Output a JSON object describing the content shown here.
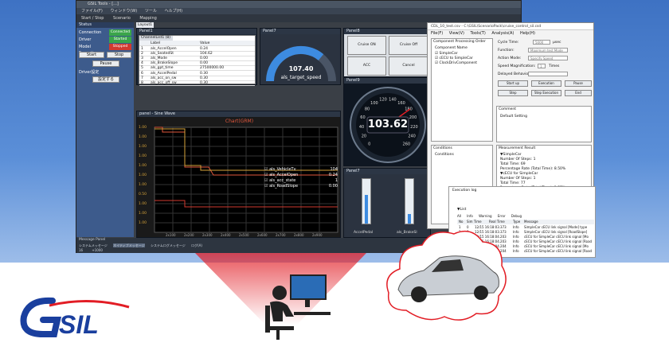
{
  "main_window": {
    "title": "GSIL Tools - [...]",
    "menu": [
      "ファイル(F)",
      "ウィンドウ(W)",
      "ツール",
      "ヘルプ(H)"
    ],
    "toolbar": [
      "Start / Stop",
      "Scenario",
      "Mapping"
    ]
  },
  "status": {
    "title": "Status",
    "rows": [
      {
        "label": "Connection",
        "value": "Connected",
        "color": "#3aa54a"
      },
      {
        "label": "Driver",
        "value": "Started",
        "color": "#3aa54a"
      },
      {
        "label": "Model Execution",
        "value": "Stopped",
        "color": "#d23a2f"
      }
    ],
    "start": "Start",
    "stop": "Stop",
    "pause": "Pause",
    "driver_label": "Driver設定",
    "settings": "設定する"
  },
  "layout_tab": "Layout1",
  "channel_list": {
    "panel": "Panel1",
    "tab": "ChannelList1 (8)",
    "cols": [
      "Label",
      "Value"
    ],
    "rows": [
      {
        "n": "1",
        "label": "als_AccelOpen",
        "value": "0.24"
      },
      {
        "n": "2",
        "label": "als_SeatedSt",
        "value": "104.62"
      },
      {
        "n": "3",
        "label": "als_Mode",
        "value": "0.00"
      },
      {
        "n": "4",
        "label": "als_BrakeSlope",
        "value": "0.00"
      },
      {
        "n": "5",
        "label": "als_gpt_time",
        "value": "27500000.00"
      },
      {
        "n": "6",
        "label": "als_AccelPedal",
        "value": "0.30"
      },
      {
        "n": "7",
        "label": "als_acc_on_sw",
        "value": "0.30"
      },
      {
        "n": "8",
        "label": "als_acc_off_sw",
        "value": "0.30"
      }
    ]
  },
  "gauge": {
    "panel": "Panel7",
    "value": "107.40",
    "label": "als_target_speed"
  },
  "cruise": {
    "panel": "Panel8",
    "buttons": [
      "Cruise ON",
      "Cruise Off",
      "ACC",
      "Cancel"
    ]
  },
  "speedometer": {
    "panel": "Panel9",
    "value": "103.62",
    "ticks": [
      "0",
      "20",
      "40",
      "60",
      "80",
      "100",
      "120",
      "140",
      "160",
      "180",
      "200",
      "220",
      "240",
      "260"
    ]
  },
  "chart": {
    "panel": "panel - Sine Wave",
    "title": "Chart(GRM)",
    "legend": [
      {
        "name": "als_VehicleTv",
        "value": "104"
      },
      {
        "name": "als_AccelOpen",
        "value": "0.24"
      },
      {
        "name": "als_acc_state",
        "value": "1"
      },
      {
        "name": "als_RoadSlope",
        "value": "0.00"
      }
    ],
    "y_ticks": [
      "1.00",
      "1.00",
      "1.00",
      "1.00",
      "1.00",
      "1.00",
      "1.00",
      "0.50",
      "1.00",
      "1.00",
      "1.00"
    ],
    "x_ticks": [
      "2x100",
      "2x200",
      "2x300",
      "2x400",
      "2x500",
      "2x600",
      "2x700",
      "2x800",
      "2x900"
    ]
  },
  "sliders": {
    "panel": "Panel7",
    "labels": [
      "AccelPedal",
      "als_BrakeSl"
    ]
  },
  "message_panel": {
    "title": "Message Panel",
    "tabs": [
      "システムメッセージ",
      "ネイティブメッセージ",
      "システムログメッセージ",
      "ログ(A)"
    ],
    "col1": "ID",
    "col2": "メッセージ",
    "row_id": "16",
    "row_val": "+1000"
  },
  "scenario": {
    "title": "CDL_10_test.csv - C:\\GSIL\\ScenarioPack\\cruise_control_sil.csd",
    "menu": [
      "File(F)",
      "View(V)",
      "Tools(T)",
      "Analysis(A)",
      "Help(H)"
    ],
    "order_title": "Component Processing Order",
    "order_col": "Component Name",
    "components": [
      "SimpleCar",
      "cECU to SimpleCar",
      "ClockDrivComponent"
    ],
    "cycle_label": "Cycle Time:",
    "cycle_value": "5000",
    "cycle_unit": "μsec",
    "function_label": "Function:",
    "function_value": "Maximum test Mode",
    "action_label": "Action Mode:",
    "action_value": "Specify Speed",
    "speed_label": "Speed Magnification:",
    "speed_value": "1",
    "speed_unit": "Times",
    "delayed_label": "Delayed Behavior:",
    "btns": [
      "Start up",
      "Execution",
      "Pause",
      "Step",
      "Step Execution",
      "End"
    ],
    "comment_title": "Comment",
    "comment_value": "Default Setting",
    "cond_title": "Conditions",
    "cond_col": "Conditions",
    "meas_title": "Measurement Result",
    "meas_lines": [
      "▼SimpleCar",
      "Number Of Steps: 1",
      "Total Time: 69",
      "Percentage Rate (Total Time): 8.50%",
      "▼cECU for SimpleCar",
      "Number Of Steps: 1",
      "Total Time: 77",
      "Percentage Rate (Total Time): 1.57%"
    ]
  },
  "exec_log": {
    "title": "Execution log",
    "filter": "▼List",
    "tabs": [
      "All",
      "Info",
      "Warning",
      "Error",
      "Debug"
    ],
    "cols": [
      "No",
      "Sim Time",
      "Real Time",
      "Type",
      "Message"
    ],
    "rows": [
      {
        "no": "1",
        "sim": "0",
        "real": "12/15 16:18:03.373",
        "type": "Info",
        "msg": "SimpleCar cECU link signal [Mode] type"
      },
      {
        "no": "2",
        "sim": "0",
        "real": "12/15 16:18:03.373",
        "type": "Info",
        "msg": "SimpleCar cECU link signal [RoadSlope]"
      },
      {
        "no": "3",
        "sim": "0",
        "real": "12/15 16:18:04.203",
        "type": "Info",
        "msg": "cECU for SimpleCar cECU link signal [Mo"
      },
      {
        "no": "4",
        "sim": "0",
        "real": "12/15 16:18:04.203",
        "type": "Info",
        "msg": "cECU for SimpleCar cECU link signal [Road"
      },
      {
        "no": "5",
        "sim": "0",
        "real": "12/15 16:18:04.204",
        "type": "Info",
        "msg": "cECU for SimpleCar cECU link signal [Mo"
      },
      {
        "no": "6",
        "sim": "0",
        "real": "12/15 16:18:04.204",
        "type": "Info",
        "msg": "cECU for SimpleCar cECU link signal [Road"
      }
    ]
  },
  "logo": {
    "text": "GSIL",
    "color": "#1a3f9e",
    "accent": "#e21d25"
  }
}
